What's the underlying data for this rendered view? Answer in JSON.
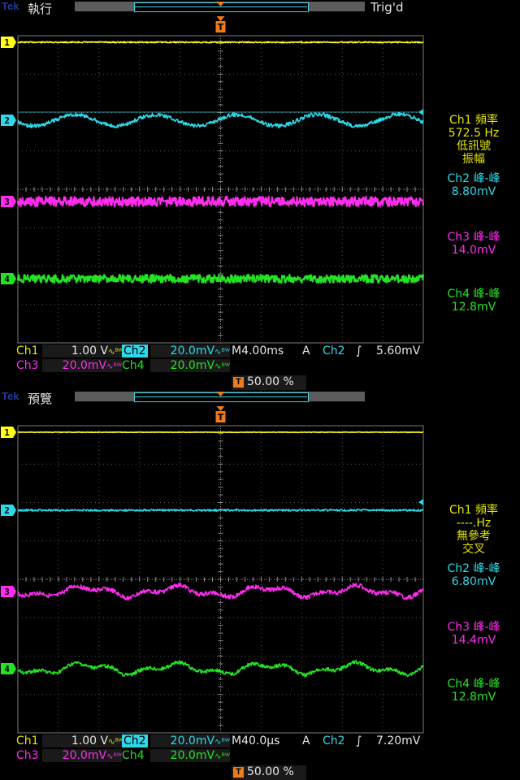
{
  "brand": "Tek",
  "colors": {
    "ch1": "#ffff1a",
    "ch2": "#2fd8e8",
    "ch3": "#ff2cf0",
    "ch4": "#24e324",
    "trigger": "#f07a1a",
    "grid": "#7a7a7a",
    "measure_label": "#e6e600"
  },
  "panels": [
    {
      "mode": "執行",
      "trig_status": "Trig'd",
      "measures": {
        "ch1": [
          "Ch1 頻率",
          "572.5 Hz",
          "低訊號",
          "振幅"
        ],
        "ch2": [
          "Ch2 峰-峰",
          "8.80mV"
        ],
        "ch3": [
          "Ch3 峰-峰",
          "14.0mV"
        ],
        "ch4": [
          "Ch4 峰-峰",
          "12.8mV"
        ]
      },
      "status": {
        "ch1_label": "Ch1",
        "ch1_scale": "1.00 V",
        "ch2_label": "Ch2",
        "ch2_scale": "20.0mV",
        "ch3_label": "Ch3",
        "ch3_scale": "20.0mV",
        "ch4_label": "Ch4",
        "ch4_scale": "20.0mV",
        "bw_icon": "∿ᴮᵂ",
        "timebase": "M4.00ms",
        "trig_mode": "A",
        "trig_source": "Ch2",
        "trig_slope": "rising-edge-icon",
        "trig_level": "5.60mV",
        "trig_position": "50.00 %"
      },
      "trace_style": {
        "ch2_wave": "sine",
        "ch2_cycles": 5
      }
    },
    {
      "mode": "預覽",
      "trig_status": "",
      "measures": {
        "ch1": [
          "Ch1 頻率",
          "----.Hz",
          "無參考",
          "交叉"
        ],
        "ch2": [
          "Ch2 峰-峰",
          "6.80mV"
        ],
        "ch3": [
          "Ch3 峰-峰",
          "14.4mV"
        ],
        "ch4": [
          "Ch4 峰-峰",
          "12.8mV"
        ]
      },
      "status": {
        "ch1_label": "Ch1",
        "ch1_scale": "1.00 V",
        "ch2_label": "Ch2",
        "ch2_scale": "20.0mV",
        "ch3_label": "Ch3",
        "ch3_scale": "20.0mV",
        "ch4_label": "Ch4",
        "ch4_scale": "20.0mV",
        "bw_icon": "∿ᴮᵂ",
        "timebase": "M40.0µs",
        "trig_mode": "A",
        "trig_source": "Ch2",
        "trig_slope": "rising-edge-icon",
        "trig_level": "7.20mV",
        "trig_position": "50.00 %"
      },
      "trace_style": {
        "ch2_wave": "flat",
        "ch2_cycles": 0
      }
    }
  ]
}
